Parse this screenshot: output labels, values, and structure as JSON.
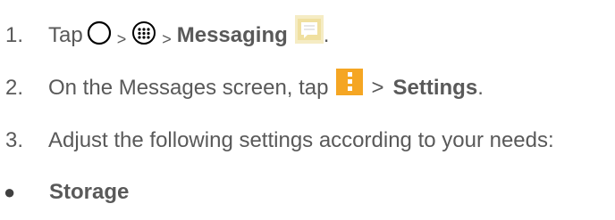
{
  "steps": [
    {
      "number": "1.",
      "tap": "Tap",
      "sep1": ">",
      "sep2": ">",
      "target": "Messaging",
      "end": "."
    },
    {
      "number": "2.",
      "prefix": "On the Messages screen, tap",
      "sep": ">",
      "target": "Settings",
      "end": "."
    },
    {
      "number": "3.",
      "text": "Adjust the following settings according to your needs:"
    }
  ],
  "bullets": [
    {
      "marker": "●",
      "label": "Storage"
    }
  ],
  "icons": {
    "home": "home-circle-icon",
    "apps": "apps-grid-icon",
    "messaging": "messaging-app-icon",
    "menu": "overflow-menu-icon"
  },
  "colors": {
    "text": "#595959",
    "menu_icon_bg": "#f5a623",
    "messaging_icon_bg": "#f3e6a6"
  }
}
